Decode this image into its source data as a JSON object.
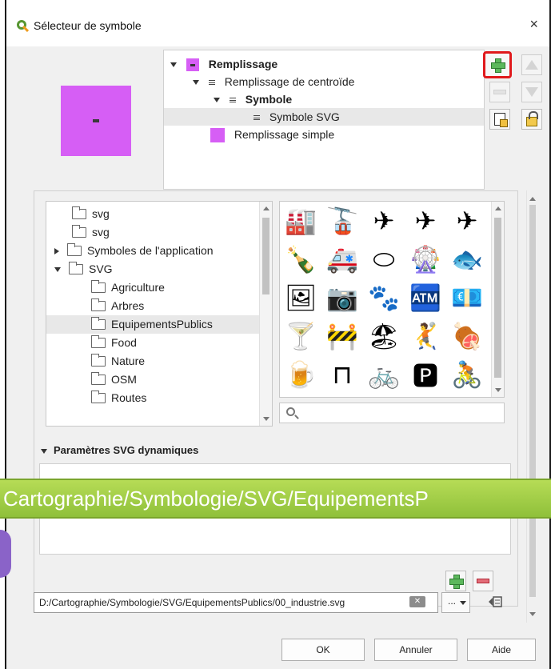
{
  "window": {
    "title": "Sélecteur de symbole",
    "close_glyph": "×",
    "app_icon": "qgis-icon"
  },
  "colors": {
    "fill_purple": "#d65ef5",
    "banner_green": "#9ccc45",
    "highlight_red": "#e0191c"
  },
  "layer_tree": {
    "items": [
      {
        "label": "Remplissage",
        "bold": true
      },
      {
        "label": "Remplissage de centroïde",
        "bold": false
      },
      {
        "label": "Symbole",
        "bold": true
      },
      {
        "label": "Symbole SVG",
        "bold": false,
        "selected": true
      },
      {
        "label": "Remplissage simple",
        "bold": false
      }
    ]
  },
  "layer_tools": {
    "add": "add-layer-icon",
    "remove": "remove-layer-icon",
    "move_up": "move-up-icon",
    "move_down": "move-down-icon",
    "duplicate": "duplicate-layer-icon",
    "lock": "lock-color-icon"
  },
  "folder_tree": {
    "items": [
      {
        "label": "svg",
        "arrow": "none",
        "indent": 1
      },
      {
        "label": "svg",
        "arrow": "none",
        "indent": 1
      },
      {
        "label": "Symboles de l'application",
        "arrow": "right",
        "indent": 0
      },
      {
        "label": "SVG",
        "arrow": "down",
        "indent": 0
      },
      {
        "label": "Agriculture",
        "arrow": "none",
        "indent": 2
      },
      {
        "label": "Arbres",
        "arrow": "none",
        "indent": 2
      },
      {
        "label": "EquipementsPublics",
        "arrow": "none",
        "indent": 2,
        "selected": true
      },
      {
        "label": "Food",
        "arrow": "none",
        "indent": 2
      },
      {
        "label": "Nature",
        "arrow": "none",
        "indent": 2
      },
      {
        "label": "OSM",
        "arrow": "none",
        "indent": 2
      },
      {
        "label": "Routes",
        "arrow": "none",
        "indent": 2
      }
    ]
  },
  "icon_grid": {
    "icons": [
      {
        "name": "industry-icon",
        "glyph": "🏭"
      },
      {
        "name": "cable-car-icon",
        "glyph": "🚡"
      },
      {
        "name": "airport-icon",
        "glyph": "✈"
      },
      {
        "name": "airplane-icon",
        "glyph": "✈"
      },
      {
        "name": "aircraft-icon",
        "glyph": "✈"
      },
      {
        "name": "bottle-icon",
        "glyph": "🍾"
      },
      {
        "name": "ambulance-icon",
        "glyph": "🚑"
      },
      {
        "name": "stadium-icon",
        "glyph": "⬭"
      },
      {
        "name": "ferris-wheel-icon",
        "glyph": "🎡"
      },
      {
        "name": "aquarium-icon",
        "glyph": "🐟"
      },
      {
        "name": "gallery-icon",
        "glyph": "🖼"
      },
      {
        "name": "camera-icon",
        "glyph": "📷"
      },
      {
        "name": "bear-paw-icon",
        "glyph": "🐾"
      },
      {
        "name": "atm-icon",
        "glyph": "🏧"
      },
      {
        "name": "banknote-icon",
        "glyph": "💶"
      },
      {
        "name": "bar-icon",
        "glyph": "🍸"
      },
      {
        "name": "barrier-icon",
        "glyph": "🚧"
      },
      {
        "name": "beach-icon",
        "glyph": "🏖"
      },
      {
        "name": "sport-icon",
        "glyph": "🤾"
      },
      {
        "name": "barbecue-icon",
        "glyph": "🍖"
      },
      {
        "name": "beer-icon",
        "glyph": "🍺"
      },
      {
        "name": "bench-icon",
        "glyph": "⊓"
      },
      {
        "name": "bicycle-icon",
        "glyph": "🚲"
      },
      {
        "name": "bicycle-parking-icon",
        "glyph": "🅿"
      },
      {
        "name": "cyclist-icon",
        "glyph": "🚴"
      }
    ]
  },
  "search": {
    "placeholder": "",
    "icon": "search-icon"
  },
  "dynamic_params": {
    "header": "Paramètres SVG dynamiques"
  },
  "path_field": {
    "value": "D:/Cartographie/Symbologie/SVG/EquipementsPublics/00_industrie.svg",
    "dots_label": "..."
  },
  "overlay_banner": {
    "text": "Cartographie/Symbologie/SVG/EquipementsP"
  },
  "buttons": {
    "ok": "OK",
    "cancel": "Annuler",
    "help": "Aide"
  }
}
